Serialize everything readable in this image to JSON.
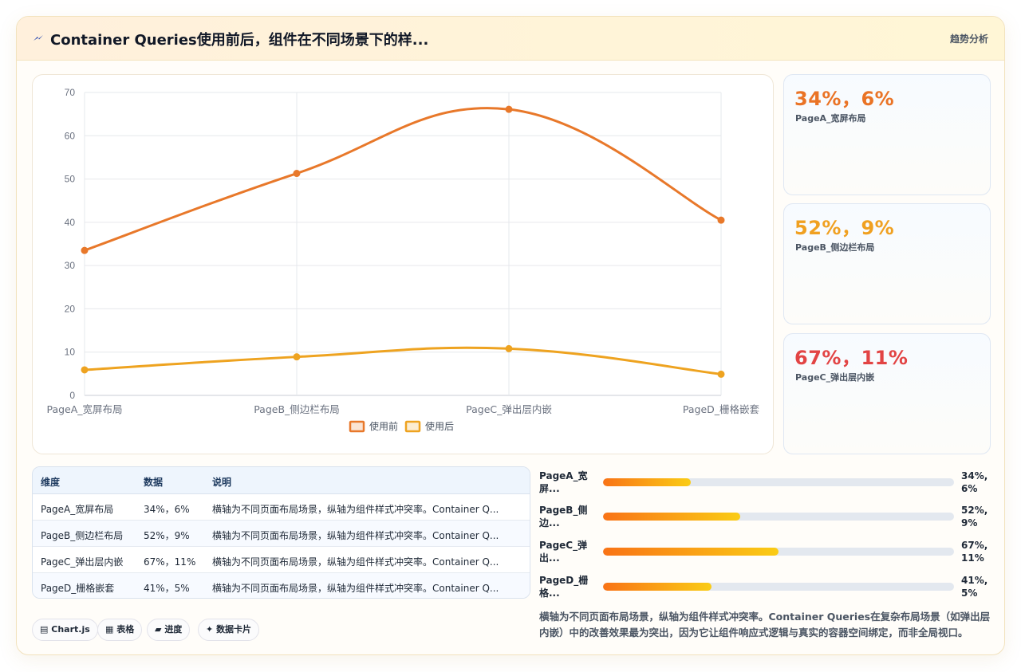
{
  "header": {
    "title": "Container Queries使用前后，组件在不同场景下的样...",
    "tag": "趋势分析",
    "accent": "#1e40af"
  },
  "chart_data": {
    "type": "line",
    "categories": [
      "PageA_宽屏布局",
      "PageB_侧边栏布局",
      "PageC_弹出层内嵌",
      "PageD_栅格嵌套"
    ],
    "series": [
      {
        "name": "使用前",
        "values": [
          33.5,
          51.3,
          66.1,
          40.5
        ],
        "color": "#e8782a"
      },
      {
        "name": "使用后",
        "values": [
          5.9,
          8.9,
          10.8,
          4.9
        ],
        "color": "#eea320"
      }
    ],
    "yticks": [
      "0",
      "10",
      "20",
      "30",
      "40",
      "50",
      "60",
      "70"
    ],
    "ylim": [
      0,
      70
    ],
    "grid": true,
    "legend": "bottom"
  },
  "kpis": [
    {
      "value": "34%，6%",
      "label": "PageA_宽屏布局",
      "color": "#ea7325"
    },
    {
      "value": "52%，9%",
      "label": "PageB_侧边栏布局",
      "color": "#f0a020"
    },
    {
      "value": "67%，11%",
      "label": "PageC_弹出层内嵌",
      "color": "#e24444"
    }
  ],
  "table": {
    "headers": [
      "维度",
      "数据",
      "说明"
    ],
    "rows": [
      [
        "PageA_宽屏布局",
        "34%，6%",
        "横轴为不同页面布局场景，纵轴为组件样式冲突率。Container Q..."
      ],
      [
        "PageB_侧边栏布局",
        "52%，9%",
        "横轴为不同页面布局场景，纵轴为组件样式冲突率。Container Q..."
      ],
      [
        "PageC_弹出层内嵌",
        "67%，11%",
        "横轴为不同页面布局场景，纵轴为组件样式冲突率。Container Q..."
      ],
      [
        "PageD_栅格嵌套",
        "41%，5%",
        "横轴为不同页面布局场景，纵轴为组件样式冲突率。Container Q..."
      ]
    ]
  },
  "progress": [
    {
      "line1": "PageA_宽",
      "line2": "屏...",
      "value1": "34%,",
      "value2": "6%",
      "level": 0.25
    },
    {
      "line1": "PageB_侧",
      "line2": "边...",
      "value1": "52%,",
      "value2": "9%",
      "level": 0.39
    },
    {
      "line1": "PageC_弹",
      "line2": "出...",
      "value1": "67%,",
      "value2": "11%",
      "level": 0.5
    },
    {
      "line1": "PageD_栅",
      "line2": "格...",
      "value1": "41%,",
      "value2": "5%",
      "level": 0.31
    }
  ],
  "chips": [
    {
      "icon": "▤",
      "label": "Chart.js"
    },
    {
      "icon": "▦",
      "label": "表格"
    },
    {
      "icon": "▰",
      "label": "进度"
    },
    {
      "icon": "✦",
      "label": "数据卡片"
    }
  ],
  "summary": "横轴为不同页面布局场景，纵轴为组件样式冲突率。Container Queries在复杂布局场景（如弹出层内嵌）中的改善效果最为突出，因为它让组件响应式逻辑与真实的容器空间绑定，而非全局视口。"
}
